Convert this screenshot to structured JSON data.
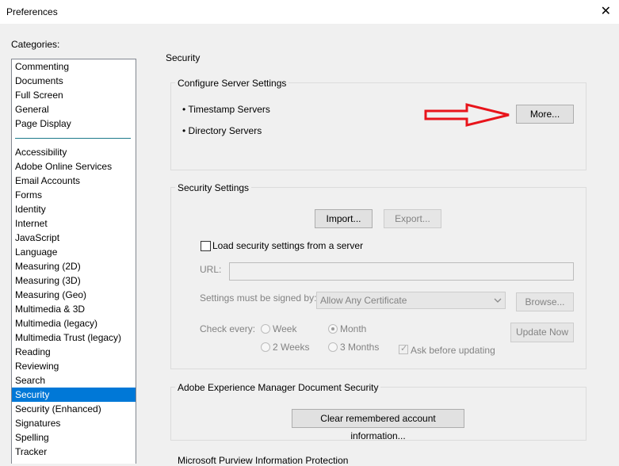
{
  "window": {
    "title": "Preferences",
    "close_glyph": "✕"
  },
  "categories": {
    "label": "Categories:",
    "group1": [
      "Commenting",
      "Documents",
      "Full Screen",
      "General",
      "Page Display"
    ],
    "group2": [
      "Accessibility",
      "Adobe Online Services",
      "Email Accounts",
      "Forms",
      "Identity",
      "Internet",
      "JavaScript",
      "Language",
      "Measuring (2D)",
      "Measuring (3D)",
      "Measuring (Geo)",
      "Multimedia & 3D",
      "Multimedia (legacy)",
      "Multimedia Trust (legacy)",
      "Reading",
      "Reviewing",
      "Search",
      "Security",
      "Security (Enhanced)",
      "Signatures",
      "Spelling",
      "Tracker"
    ],
    "selected": "Security"
  },
  "page": {
    "title": "Security"
  },
  "server_settings": {
    "title": "Configure Server Settings",
    "items": [
      "• Timestamp Servers",
      "• Directory Servers"
    ],
    "more_button": "More..."
  },
  "security_settings": {
    "title": "Security Settings",
    "import_button": "Import...",
    "export_button": "Export...",
    "load_checkbox_label": "Load security settings from a server",
    "load_checked": false,
    "url_label": "URL:",
    "url_value": "",
    "signed_by_label": "Settings must be signed by:",
    "signed_by_value": "Allow Any Certificate",
    "browse_button": "Browse...",
    "check_every_label": "Check every:",
    "options": [
      "Week",
      "Month",
      "2 Weeks",
      "3 Months"
    ],
    "selected_option": "Month",
    "update_button": "Update Now",
    "ask_label": "Ask before updating",
    "ask_checked": true
  },
  "aem": {
    "title": "Adobe Experience Manager Document Security",
    "clear_button": "Clear remembered account information..."
  },
  "purview": {
    "title": "Microsoft Purview Information Protection"
  },
  "annotation": {
    "arrow_color": "#e8141b"
  }
}
